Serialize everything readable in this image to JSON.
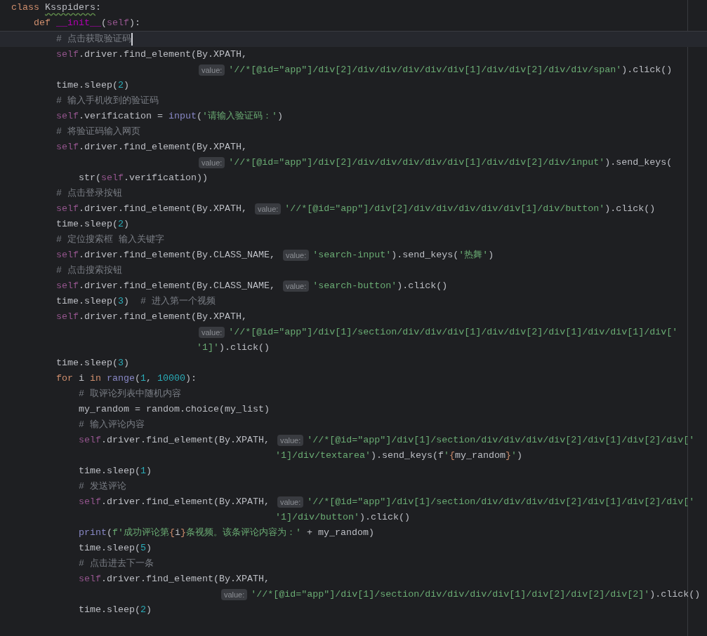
{
  "editor": {
    "sticky_lines": [
      {
        "current": false,
        "tokens": [
          {
            "kind": "keyword",
            "text": "class "
          },
          {
            "kind": "flagged",
            "text": "Ksspiders"
          },
          {
            "kind": "plain",
            "text": ":"
          }
        ]
      },
      {
        "current": false,
        "tokens": [
          {
            "kind": "keyword",
            "text": "    def "
          },
          {
            "kind": "magic",
            "text": "__init__"
          },
          {
            "kind": "plain",
            "text": "("
          },
          {
            "kind": "self",
            "text": "self"
          },
          {
            "kind": "plain",
            "text": "):"
          }
        ]
      }
    ],
    "lines": [
      {
        "current": true,
        "tokens": [
          {
            "kind": "comment",
            "text": "        # 点击获取验证码"
          }
        ]
      },
      {
        "current": false,
        "tokens": [
          {
            "kind": "self",
            "text": "        self"
          },
          {
            "kind": "plain",
            "text": ".driver.find_element(By.XPATH,"
          }
        ]
      },
      {
        "current": false,
        "tokens": [
          {
            "kind": "hint",
            "text": "                                 value:"
          },
          {
            "kind": "string",
            "text": "'//*[@id=\"app\"]/div[2]/div/div/div/div/div[1]/div/div[2]/div/div/span'"
          },
          {
            "kind": "plain",
            "text": ").click()"
          }
        ]
      },
      {
        "current": false,
        "tokens": [
          {
            "kind": "plain",
            "text": "        time.sleep("
          },
          {
            "kind": "number",
            "text": "2"
          },
          {
            "kind": "plain",
            "text": ")"
          }
        ]
      },
      {
        "current": false,
        "tokens": [
          {
            "kind": "comment",
            "text": "        # 输入手机收到的验证码"
          }
        ]
      },
      {
        "current": false,
        "tokens": [
          {
            "kind": "self",
            "text": "        self"
          },
          {
            "kind": "plain",
            "text": ".verification = "
          },
          {
            "kind": "builtin",
            "text": "input"
          },
          {
            "kind": "plain",
            "text": "("
          },
          {
            "kind": "string",
            "text": "'请输入验证码：'"
          },
          {
            "kind": "plain",
            "text": ")"
          }
        ]
      },
      {
        "current": false,
        "tokens": [
          {
            "kind": "comment",
            "text": "        # 将验证码输入网页"
          }
        ]
      },
      {
        "current": false,
        "tokens": [
          {
            "kind": "self",
            "text": "        self"
          },
          {
            "kind": "plain",
            "text": ".driver.find_element(By.XPATH,"
          }
        ]
      },
      {
        "current": false,
        "tokens": [
          {
            "kind": "hint",
            "text": "                                 value:"
          },
          {
            "kind": "string",
            "text": "'//*[@id=\"app\"]/div[2]/div/div/div/div/div[1]/div/div[2]/div/input'"
          },
          {
            "kind": "plain",
            "text": ").send_keys("
          }
        ]
      },
      {
        "current": false,
        "tokens": [
          {
            "kind": "plain",
            "text": "            str("
          },
          {
            "kind": "self",
            "text": "self"
          },
          {
            "kind": "plain",
            "text": ".verification))"
          }
        ]
      },
      {
        "current": false,
        "tokens": [
          {
            "kind": "comment",
            "text": "        # 点击登录按钮"
          }
        ]
      },
      {
        "current": false,
        "tokens": [
          {
            "kind": "self",
            "text": "        self"
          },
          {
            "kind": "plain",
            "text": ".driver.find_element(By.XPATH,"
          },
          {
            "kind": "hint",
            "text": " value:"
          },
          {
            "kind": "string",
            "text": "'//*[@id=\"app\"]/div[2]/div/div/div/div/div[1]/div/button'"
          },
          {
            "kind": "plain",
            "text": ").click()"
          }
        ]
      },
      {
        "current": false,
        "tokens": [
          {
            "kind": "plain",
            "text": "        time.sleep("
          },
          {
            "kind": "number",
            "text": "2"
          },
          {
            "kind": "plain",
            "text": ")"
          }
        ]
      },
      {
        "current": false,
        "tokens": [
          {
            "kind": "comment",
            "text": "        # 定位搜索框 输入关键字"
          }
        ]
      },
      {
        "current": false,
        "tokens": [
          {
            "kind": "self",
            "text": "        self"
          },
          {
            "kind": "plain",
            "text": ".driver.find_element(By.CLASS_NAME,"
          },
          {
            "kind": "hint",
            "text": " value:"
          },
          {
            "kind": "string",
            "text": "'search-input'"
          },
          {
            "kind": "plain",
            "text": ").send_keys("
          },
          {
            "kind": "string",
            "text": "'热舞'"
          },
          {
            "kind": "plain",
            "text": ")"
          }
        ]
      },
      {
        "current": false,
        "tokens": [
          {
            "kind": "comment",
            "text": "        # 点击搜索按钮"
          }
        ]
      },
      {
        "current": false,
        "tokens": [
          {
            "kind": "self",
            "text": "        self"
          },
          {
            "kind": "plain",
            "text": ".driver.find_element(By.CLASS_NAME,"
          },
          {
            "kind": "hint",
            "text": " value:"
          },
          {
            "kind": "string",
            "text": "'search-button'"
          },
          {
            "kind": "plain",
            "text": ").click()"
          }
        ]
      },
      {
        "current": false,
        "tokens": [
          {
            "kind": "plain",
            "text": "        time.sleep("
          },
          {
            "kind": "number",
            "text": "3"
          },
          {
            "kind": "plain",
            "text": ")"
          },
          {
            "kind": "comment",
            "text": "  # 进入第一个视频"
          }
        ]
      },
      {
        "current": false,
        "tokens": [
          {
            "kind": "self",
            "text": "        self"
          },
          {
            "kind": "plain",
            "text": ".driver.find_element(By.XPATH,"
          }
        ]
      },
      {
        "current": false,
        "tokens": [
          {
            "kind": "hint",
            "text": "                                 value:"
          },
          {
            "kind": "string",
            "text": "'//*[@id=\"app\"]/div[1]/section/div/div/div[1]/div/div[2]/div[1]/div/div[1]/div['"
          }
        ]
      },
      {
        "current": false,
        "tokens": [
          {
            "kind": "string",
            "text": "                                 '1]'"
          },
          {
            "kind": "plain",
            "text": ").click()"
          }
        ]
      },
      {
        "current": false,
        "tokens": [
          {
            "kind": "plain",
            "text": "        time.sleep("
          },
          {
            "kind": "number",
            "text": "3"
          },
          {
            "kind": "plain",
            "text": ")"
          }
        ]
      },
      {
        "current": false,
        "tokens": [
          {
            "kind": "keyword",
            "text": "        for"
          },
          {
            "kind": "plain",
            "text": " i "
          },
          {
            "kind": "keyword",
            "text": "in "
          },
          {
            "kind": "builtin",
            "text": "range"
          },
          {
            "kind": "plain",
            "text": "("
          },
          {
            "kind": "number",
            "text": "1"
          },
          {
            "kind": "plain",
            "text": ", "
          },
          {
            "kind": "number",
            "text": "10000"
          },
          {
            "kind": "plain",
            "text": "):"
          }
        ]
      },
      {
        "current": false,
        "tokens": [
          {
            "kind": "comment",
            "text": "            # 取评论列表中随机内容"
          }
        ]
      },
      {
        "current": false,
        "tokens": [
          {
            "kind": "plain",
            "text": "            my_random = random.choice(my_list)"
          }
        ]
      },
      {
        "current": false,
        "tokens": [
          {
            "kind": "comment",
            "text": "            # 输入评论内容"
          }
        ]
      },
      {
        "current": false,
        "tokens": [
          {
            "kind": "self",
            "text": "            self"
          },
          {
            "kind": "plain",
            "text": ".driver.find_element(By.XPATH,"
          },
          {
            "kind": "hint",
            "text": " value:"
          },
          {
            "kind": "string",
            "text": "'//*[@id=\"app\"]/div[1]/section/div/div/div/div[2]/div[1]/div[2]/div['"
          }
        ]
      },
      {
        "current": false,
        "tokens": [
          {
            "kind": "string",
            "text": "                                               '1]/div/textarea'"
          },
          {
            "kind": "plain",
            "text": ").send_keys(f"
          },
          {
            "kind": "string",
            "text": "'"
          },
          {
            "kind": "brace",
            "text": "{"
          },
          {
            "kind": "plain",
            "text": "my_random"
          },
          {
            "kind": "brace",
            "text": "}"
          },
          {
            "kind": "string",
            "text": "'"
          },
          {
            "kind": "plain",
            "text": ")"
          }
        ]
      },
      {
        "current": false,
        "tokens": [
          {
            "kind": "plain",
            "text": "            time.sleep("
          },
          {
            "kind": "number",
            "text": "1"
          },
          {
            "kind": "plain",
            "text": ")"
          }
        ]
      },
      {
        "current": false,
        "tokens": [
          {
            "kind": "comment",
            "text": "            # 发送评论"
          }
        ]
      },
      {
        "current": false,
        "tokens": [
          {
            "kind": "self",
            "text": "            self"
          },
          {
            "kind": "plain",
            "text": ".driver.find_element(By.XPATH,"
          },
          {
            "kind": "hint",
            "text": " value:"
          },
          {
            "kind": "string",
            "text": "'//*[@id=\"app\"]/div[1]/section/div/div/div/div[2]/div[1]/div[2]/div['"
          }
        ]
      },
      {
        "current": false,
        "tokens": [
          {
            "kind": "string",
            "text": "                                               '1]/div/button'"
          },
          {
            "kind": "plain",
            "text": ").click()"
          }
        ]
      },
      {
        "current": false,
        "tokens": [
          {
            "kind": "builtin",
            "text": "            print"
          },
          {
            "kind": "plain",
            "text": "("
          },
          {
            "kind": "string",
            "text": "f'成功评论第"
          },
          {
            "kind": "brace",
            "text": "{"
          },
          {
            "kind": "plain",
            "text": "i"
          },
          {
            "kind": "brace",
            "text": "}"
          },
          {
            "kind": "string",
            "text": "条视频。该条评论内容为：'"
          },
          {
            "kind": "plain",
            "text": " + my_random)"
          }
        ]
      },
      {
        "current": false,
        "tokens": [
          {
            "kind": "plain",
            "text": "            time.sleep("
          },
          {
            "kind": "number",
            "text": "5"
          },
          {
            "kind": "plain",
            "text": ")"
          }
        ]
      },
      {
        "current": false,
        "tokens": [
          {
            "kind": "comment",
            "text": "            # 点击进去下一条"
          }
        ]
      },
      {
        "current": false,
        "tokens": [
          {
            "kind": "self",
            "text": "            self"
          },
          {
            "kind": "plain",
            "text": ".driver.find_element(By.XPATH,"
          }
        ]
      },
      {
        "current": false,
        "tokens": [
          {
            "kind": "hint",
            "text": "                                     value:"
          },
          {
            "kind": "string",
            "text": "'//*[@id=\"app\"]/div[1]/section/div/div/div/div[1]/div[2]/div[2]/div[2]'"
          },
          {
            "kind": "plain",
            "text": ").click()"
          }
        ]
      },
      {
        "current": false,
        "tokens": [
          {
            "kind": "plain",
            "text": "            time.sleep("
          },
          {
            "kind": "number",
            "text": "2"
          },
          {
            "kind": "plain",
            "text": ")"
          }
        ]
      }
    ]
  }
}
